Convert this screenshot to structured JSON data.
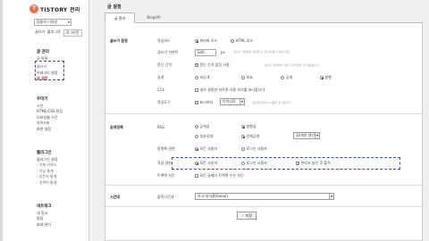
{
  "sidebar": {
    "logo_text": "TISTORY 관리",
    "logo_letter": "T",
    "blog_select_value": "정중의 디자인",
    "links": {
      "write": "글쓰기",
      "blog": "블로그로",
      "logout": "로그아웃"
    },
    "sections": [
      {
        "title": "글 관리",
        "items": [
          "글 목록",
          "글쓰기",
          "카테고리 설정",
          "글 설정"
        ]
      },
      {
        "title": "꾸미기",
        "items": [
          "스킨",
          "HTML/CSS 편집",
          "모바일웹 스킨",
          "사이드바",
          "화면 설정"
        ]
      },
      {
        "title": "플러그인",
        "items": [
          "플러그인 설정",
          "- 리퍼 키워드",
          "- 유입 통계",
          "- 방문자 통계",
          "- 검색어 통계"
        ]
      },
      {
        "title": "네트워크",
        "items": [
          "내 링크",
          "알림",
          "초대 관리"
        ]
      }
    ]
  },
  "main": {
    "page_title": "글 설정",
    "tabs": [
      "글 관리",
      "BlogAPI"
    ],
    "sections": {
      "writing": "글쓰기 환경",
      "publish": "공개정책",
      "time": "시간대"
    },
    "rows": {
      "editor_mode": {
        "label": "작성모드",
        "options": [
          "위지윅 모드",
          "HTML 모드"
        ]
      },
      "posts_per_page": {
        "label": "글쓰기 기본폭",
        "value": "640",
        "unit": "px",
        "hint": "글쓰기 기본폭은 설정을 수 있으며 글쓰기에서 접근"
      },
      "paragraph": {
        "label": "문단 간격",
        "option": "문단 간격 없음 사용",
        "hint": "글쓰기 화면에서 \"문단 간격 없음\" 을 사용합니다"
      },
      "visibility": {
        "label": "공개",
        "options": [
          "비공개",
          "보호",
          "공개",
          "발행"
        ]
      },
      "ccl": {
        "label": "CCL",
        "option": "내가 설정한 저작권 사용 허가를 표시합니다"
      },
      "author": {
        "label": "작성도구",
        "option": "표시하지",
        "select": "아이디로",
        "hint": "글쓴이(작성자) 이름을 표시합니다"
      },
      "rss": {
        "label": "RSS",
        "options": [
          "공개글",
          "발행글",
          "부분공개",
          "전체공개"
        ],
        "select": "10개로 갱신"
      },
      "comment_perm": {
        "label": "방명록 권한",
        "options": [
          "모든 사용자",
          "로그인 사용자"
        ]
      },
      "post_perm": {
        "label": "작글 권한",
        "options": [
          "모든 사용자",
          "로그인 사용자",
          "관리자 승인 후 출력"
        ]
      },
      "trackback": {
        "label": "트랙백 차단",
        "option": "모든 글에서 트랙백 수신 차단"
      },
      "timezone": {
        "label": "출력시간대",
        "select": "아시아/서울(Seoul)"
      }
    },
    "save_label": "저장",
    "save_icon": "check-icon"
  },
  "colors": {
    "accent": "#c0392b",
    "logo": "#f26b3a",
    "highlight": "#3b4bb0"
  }
}
